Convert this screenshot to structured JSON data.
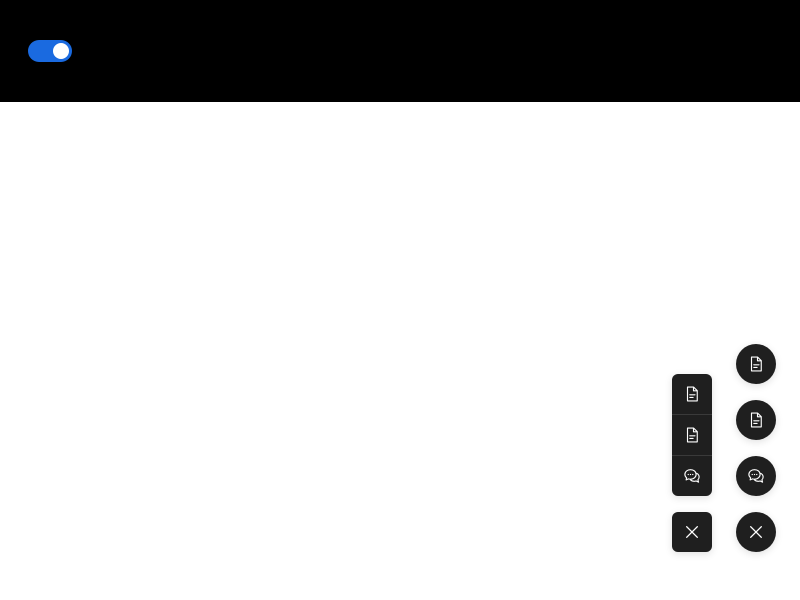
{
  "colors": {
    "toggle_on": "#1a6ae0",
    "float_button_bg": "#1f1f1f",
    "icon": "#ffffff"
  },
  "header": {
    "toggle": {
      "state": "on"
    }
  },
  "square_float_group": {
    "items": [
      {
        "icon": "file-text-icon"
      },
      {
        "icon": "file-text-icon"
      },
      {
        "icon": "comment-icon"
      }
    ],
    "close": {
      "icon": "close-icon"
    }
  },
  "circle_float_group": {
    "items": [
      {
        "icon": "file-text-icon"
      },
      {
        "icon": "file-text-icon"
      },
      {
        "icon": "comment-icon"
      }
    ],
    "close": {
      "icon": "close-icon"
    }
  }
}
